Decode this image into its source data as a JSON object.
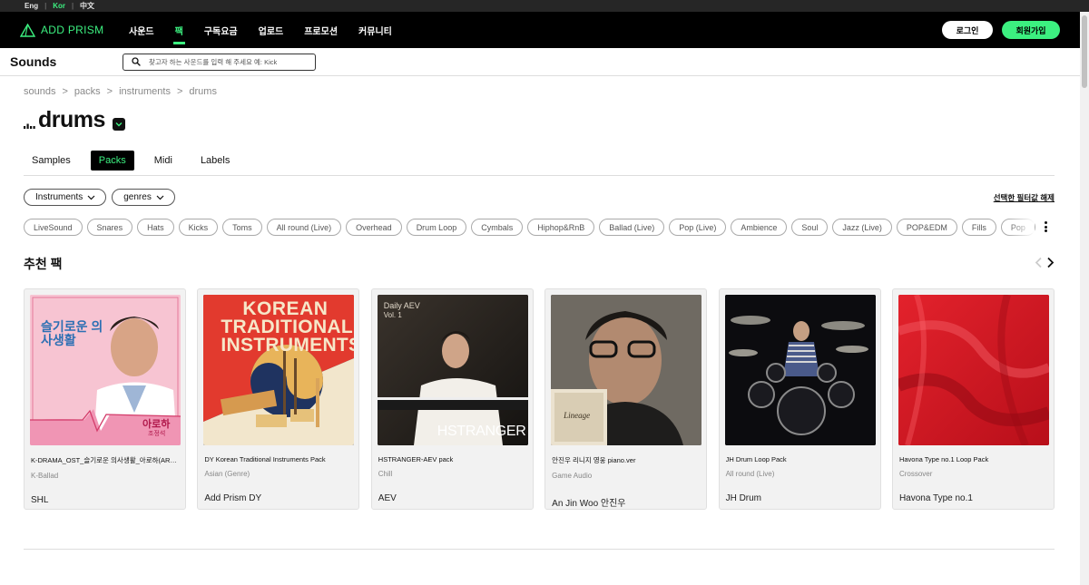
{
  "languages": [
    {
      "label": "Eng",
      "active": false
    },
    {
      "label": "Kor",
      "active": true
    },
    {
      "label": "中文",
      "active": false
    }
  ],
  "brand": {
    "name": "ADD PRISM",
    "accent": "#3cf080"
  },
  "nav": {
    "links": [
      "사운드",
      "팩",
      "구독요금",
      "업로드",
      "프로모션",
      "커뮤니티"
    ],
    "active_index": 1,
    "login_label": "로그인",
    "signup_label": "회원가입"
  },
  "sounds_header": {
    "title": "Sounds",
    "search_placeholder": "찾고자 하는 사운드를 입력 해 주세요 예: Kick"
  },
  "breadcrumb": [
    "sounds",
    "packs",
    "instruments",
    "drums"
  ],
  "page_title": "drums",
  "tabs": [
    {
      "label": "Samples",
      "active": false
    },
    {
      "label": "Packs",
      "active": true
    },
    {
      "label": "Midi",
      "active": false
    },
    {
      "label": "Labels",
      "active": false
    }
  ],
  "filters": {
    "dropdowns": [
      "Instruments",
      "genres"
    ],
    "clear_label": "선택한 필터값 해제"
  },
  "tags": [
    "LiveSound",
    "Snares",
    "Hats",
    "Kicks",
    "Toms",
    "All round (Live)",
    "Overhead",
    "Drum Loop",
    "Cymbals",
    "Hiphop&RnB",
    "Ballad (Live)",
    "Pop (Live)",
    "Ambience",
    "Soul",
    "Jazz (Live)",
    "POP&EDM",
    "Fills",
    "Pop"
  ],
  "recommended": {
    "title": "추천 팩",
    "cards": [
      {
        "name": "K-DRAMA_OST_슬기로운 의사생활_아로하(ARO...",
        "genre": "K-Ballad",
        "artist": "SHL",
        "cover_title": "슬기로운 의사생활",
        "cover_sub": "아로하",
        "cover_sub2": "조정석"
      },
      {
        "name": "DY Korean Traditional Instruments Pack",
        "genre": "Asian (Genre)",
        "artist": "Add Prism DY",
        "cover_title_line1": "KOREAN",
        "cover_title_line2": "TRADITIONAL",
        "cover_title_line3": "INSTRUMENTS"
      },
      {
        "name": "HSTRANGER-AEV pack",
        "genre": "Chill",
        "artist": "AEV",
        "cover_title": "Daily AEV",
        "cover_vol": "Vol. 1",
        "cover_brand": "HSTRANGER"
      },
      {
        "name": "안진우 리니지 영웅 piano.ver",
        "genre": "Game Audio",
        "artist": "An Jin Woo 안진우",
        "cover_logo": "Lineage"
      },
      {
        "name": "JH Drum Loop Pack",
        "genre": "All round (Live)",
        "artist": "JH Drum"
      },
      {
        "name": "Havona Type no.1 Loop Pack",
        "genre": "Crossover",
        "artist": "Havona Type no.1"
      }
    ]
  }
}
